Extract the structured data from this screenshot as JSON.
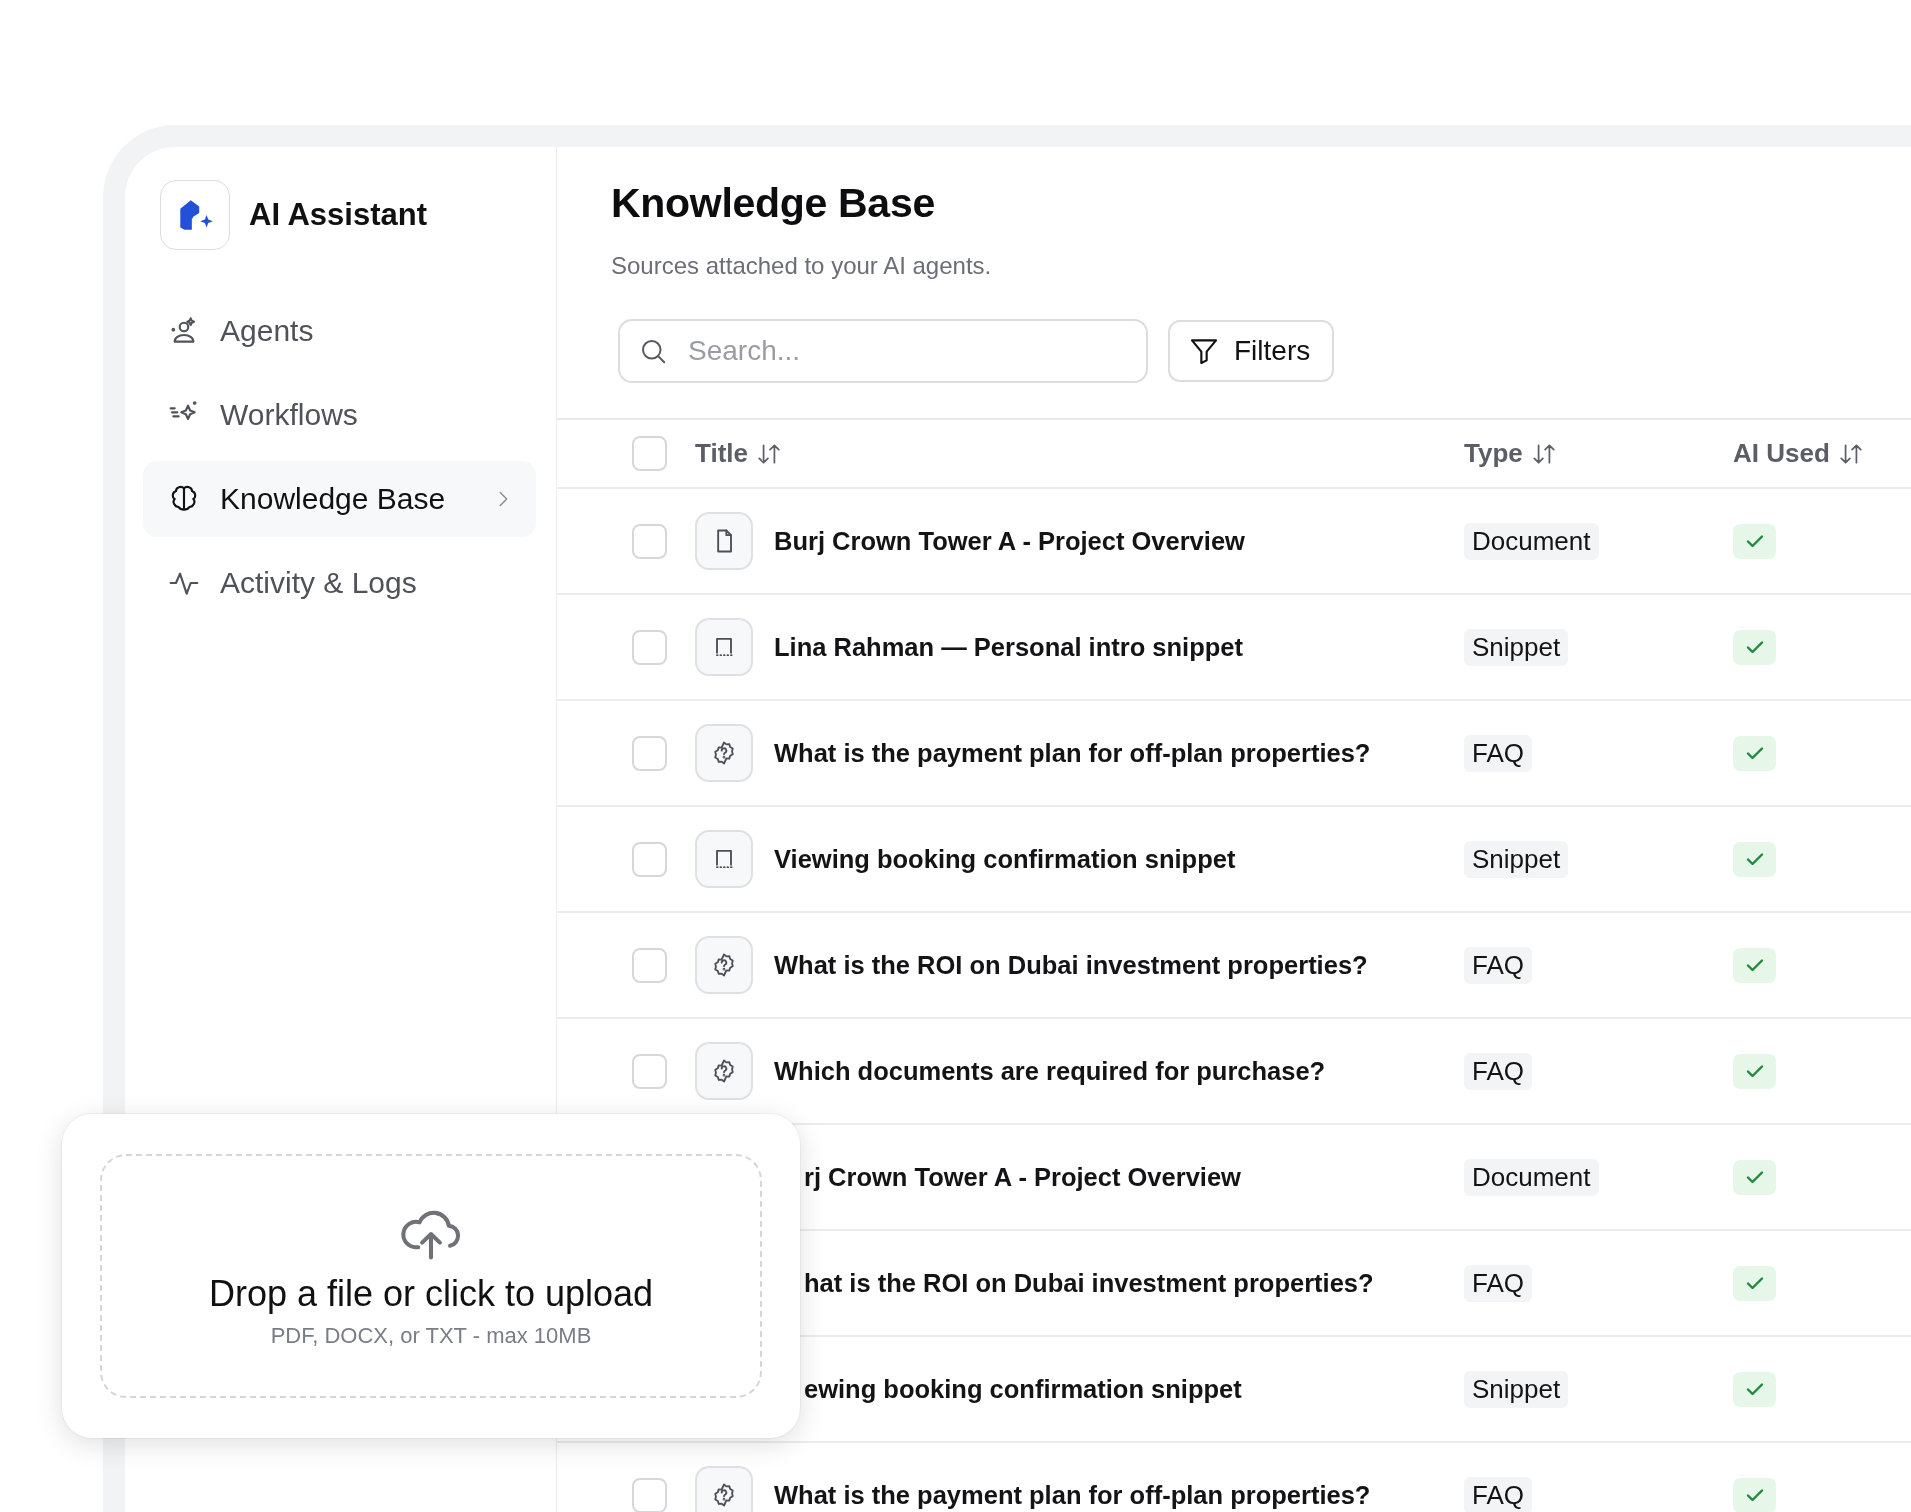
{
  "app": {
    "name": "AI Assistant"
  },
  "nav": [
    {
      "label": "Agents",
      "kind": "agents",
      "selected": false
    },
    {
      "label": "Workflows",
      "kind": "workflows",
      "selected": false
    },
    {
      "label": "Knowledge Base",
      "kind": "brain",
      "selected": true
    },
    {
      "label": "Activity & Logs",
      "kind": "activity",
      "selected": false
    }
  ],
  "page": {
    "title": "Knowledge Base",
    "subtitle": "Sources attached to your AI agents."
  },
  "search": {
    "placeholder": "Search..."
  },
  "filters_button": {
    "label": "Filters"
  },
  "table": {
    "select_all": {
      "checked": false
    },
    "columns": [
      "Title",
      "Type",
      "AI Used"
    ],
    "rows": [
      {
        "kind": "document",
        "title": "Burj Crown Tower A - Project Overview",
        "type": "Document",
        "ai_used": true,
        "checked": false
      },
      {
        "kind": "snippet",
        "title": "Lina Rahman — Personal intro snippet",
        "type": "Snippet",
        "ai_used": true,
        "checked": false
      },
      {
        "kind": "faq",
        "title": "What is the payment plan for off-plan properties?",
        "type": "FAQ",
        "ai_used": true,
        "checked": false
      },
      {
        "kind": "snippet",
        "title": "Viewing booking confirmation snippet",
        "type": "Snippet",
        "ai_used": true,
        "checked": false
      },
      {
        "kind": "faq",
        "title": "What is the ROI on Dubai investment properties?",
        "type": "FAQ",
        "ai_used": true,
        "checked": false
      },
      {
        "kind": "faq",
        "title": "Which documents are required for purchase?",
        "type": "FAQ",
        "ai_used": true,
        "checked": false
      },
      {
        "kind": "covered",
        "title": "rj Crown Tower A - Project Overview",
        "type": "Document",
        "ai_used": true
      },
      {
        "kind": "covered",
        "title": "hat is the ROI on Dubai investment properties?",
        "type": "FAQ",
        "ai_used": true
      },
      {
        "kind": "covered",
        "title": "ewing booking confirmation snippet",
        "type": "Snippet",
        "ai_used": true
      },
      {
        "kind": "faq",
        "title": "What is the payment plan for off-plan properties?",
        "type": "FAQ",
        "ai_used": true,
        "checked": false
      }
    ]
  },
  "upload": {
    "title": "Drop a file or click to upload",
    "hint": "PDF, DOCX, or TXT - max 10MB"
  }
}
